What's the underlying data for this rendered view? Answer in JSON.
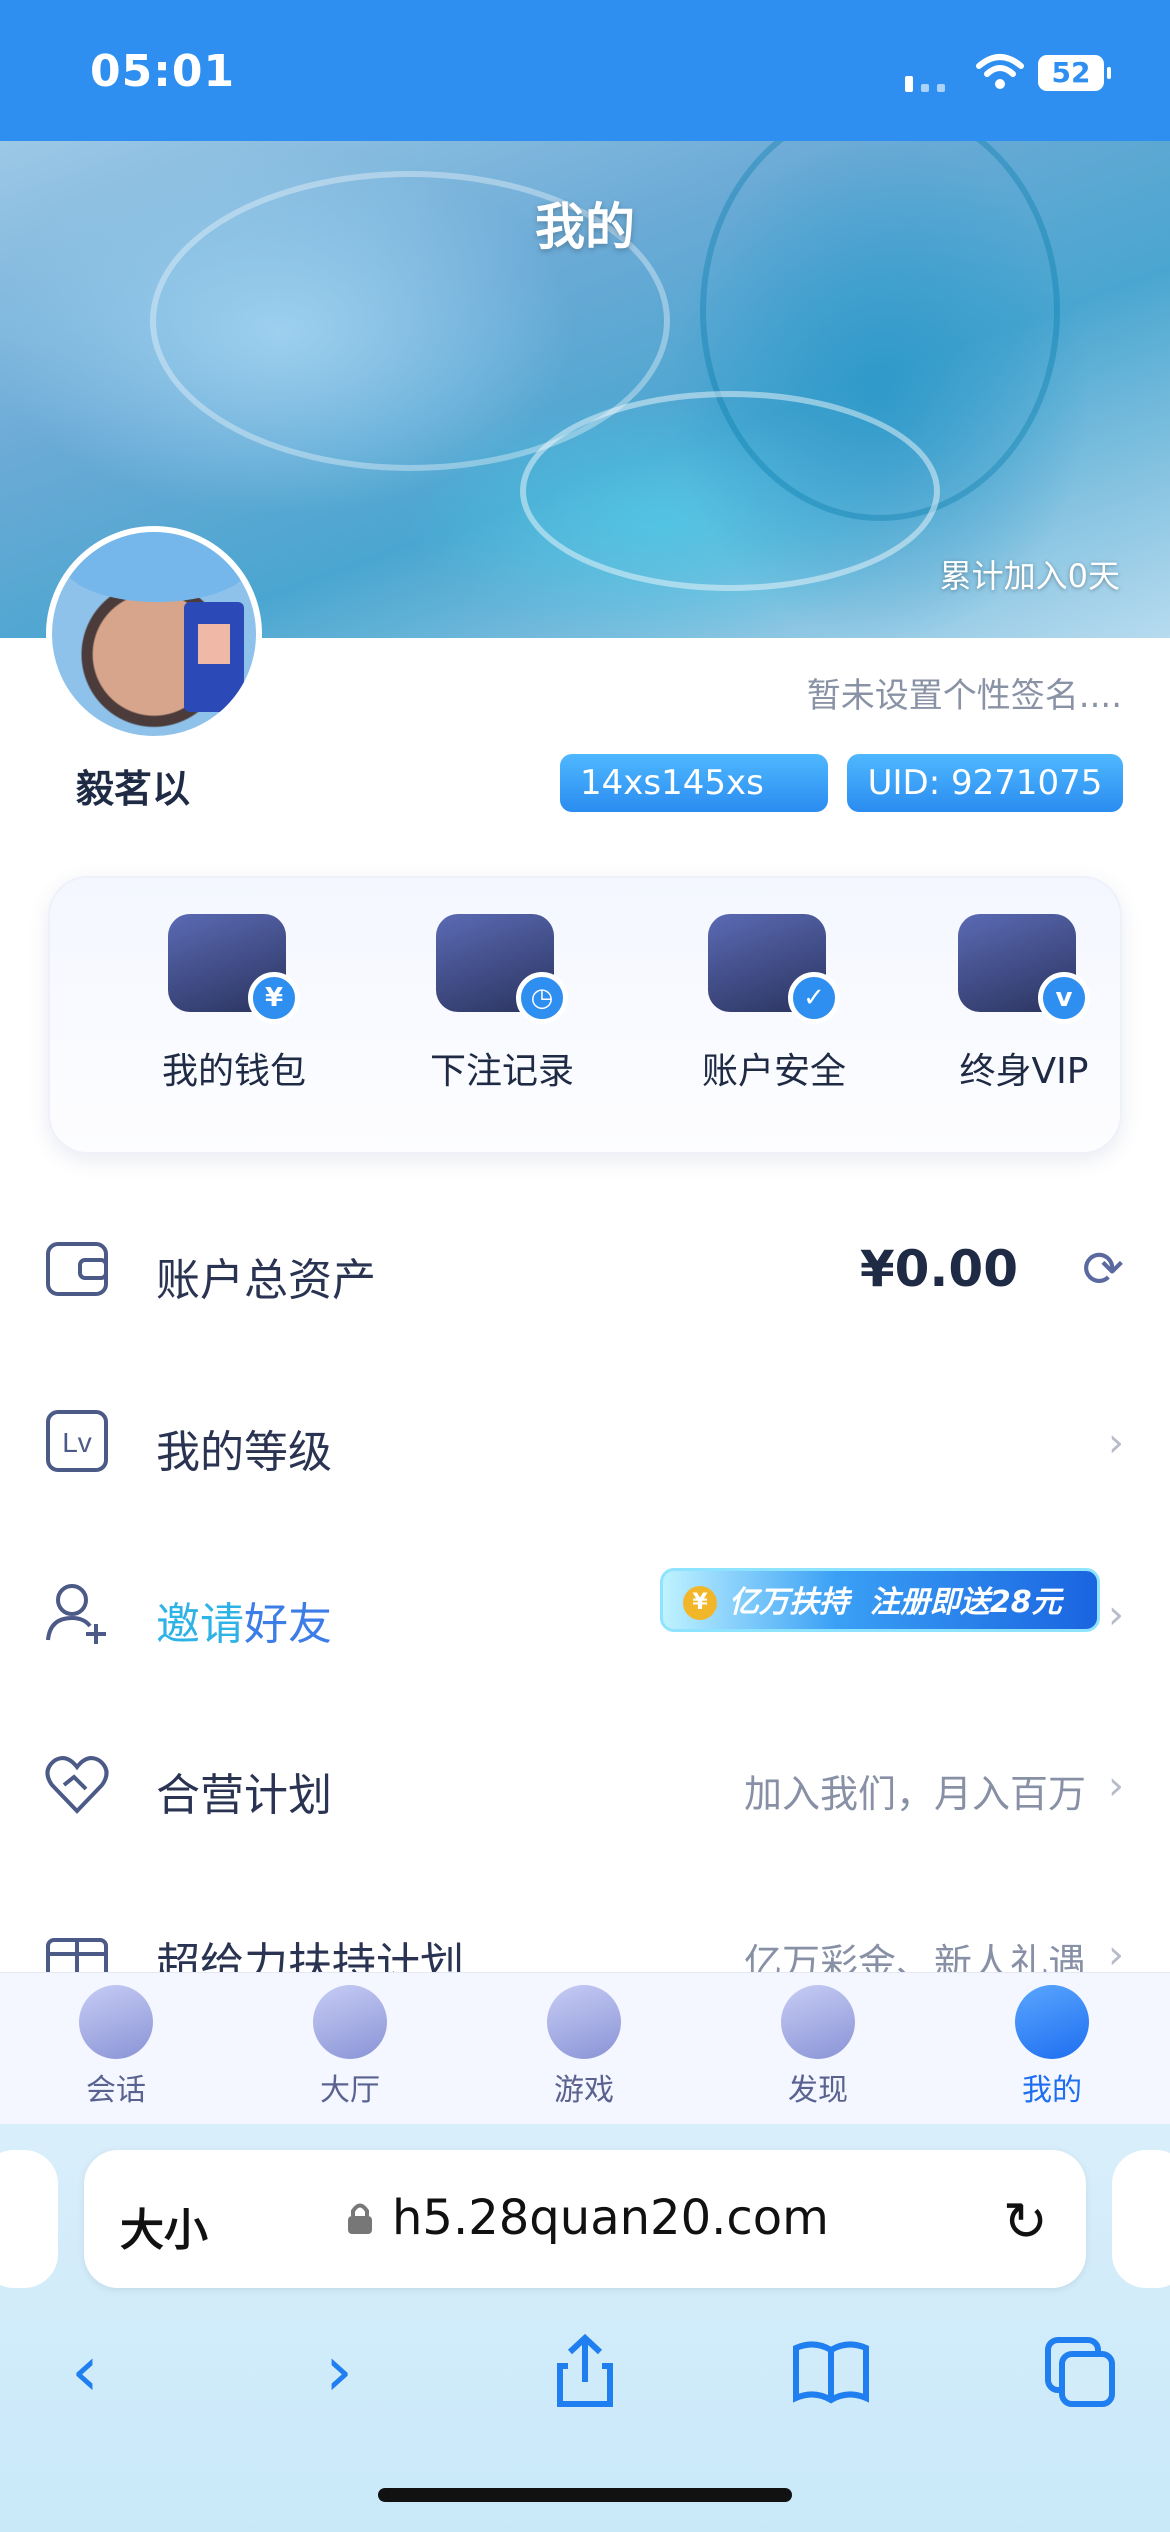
{
  "status_bar": {
    "time": "05:01",
    "battery": "52"
  },
  "banner": {
    "title": "我的",
    "join_days": "累计加入0天"
  },
  "profile": {
    "signature": "暂未设置个性签名....",
    "username": "毅茗以",
    "tag": "14xs145xs",
    "uid": "UID: 9271075"
  },
  "quick_actions": [
    {
      "label": "我的钱包",
      "badge": "¥"
    },
    {
      "label": "下注记录",
      "badge": "◷"
    },
    {
      "label": "账户安全",
      "badge": "✓"
    },
    {
      "label": "终身VIP",
      "badge": "v"
    }
  ],
  "menu": {
    "assets": {
      "label": "账户总资产",
      "amount": "¥0.00"
    },
    "level": {
      "label": "我的等级"
    },
    "invite": {
      "label_a": "邀请",
      "label_b": "好友",
      "promo_a": "亿万扶持",
      "promo_b": "注册即送28元"
    },
    "partner": {
      "label": "合营计划",
      "hint": "加入我们，月入百万"
    },
    "support": {
      "label": "超给力扶持计划",
      "hint": "亿万彩金、新人礼遇"
    }
  },
  "tabbar": [
    {
      "label": "会话"
    },
    {
      "label": "大厅"
    },
    {
      "label": "游戏"
    },
    {
      "label": "发现"
    },
    {
      "label": "我的"
    }
  ],
  "browser": {
    "text_size": "大小",
    "url": "h5.28quan20.com"
  },
  "colors": {
    "primary": "#2f8ff0",
    "accent": "#1e6ef0",
    "text": "#1f2a44"
  }
}
